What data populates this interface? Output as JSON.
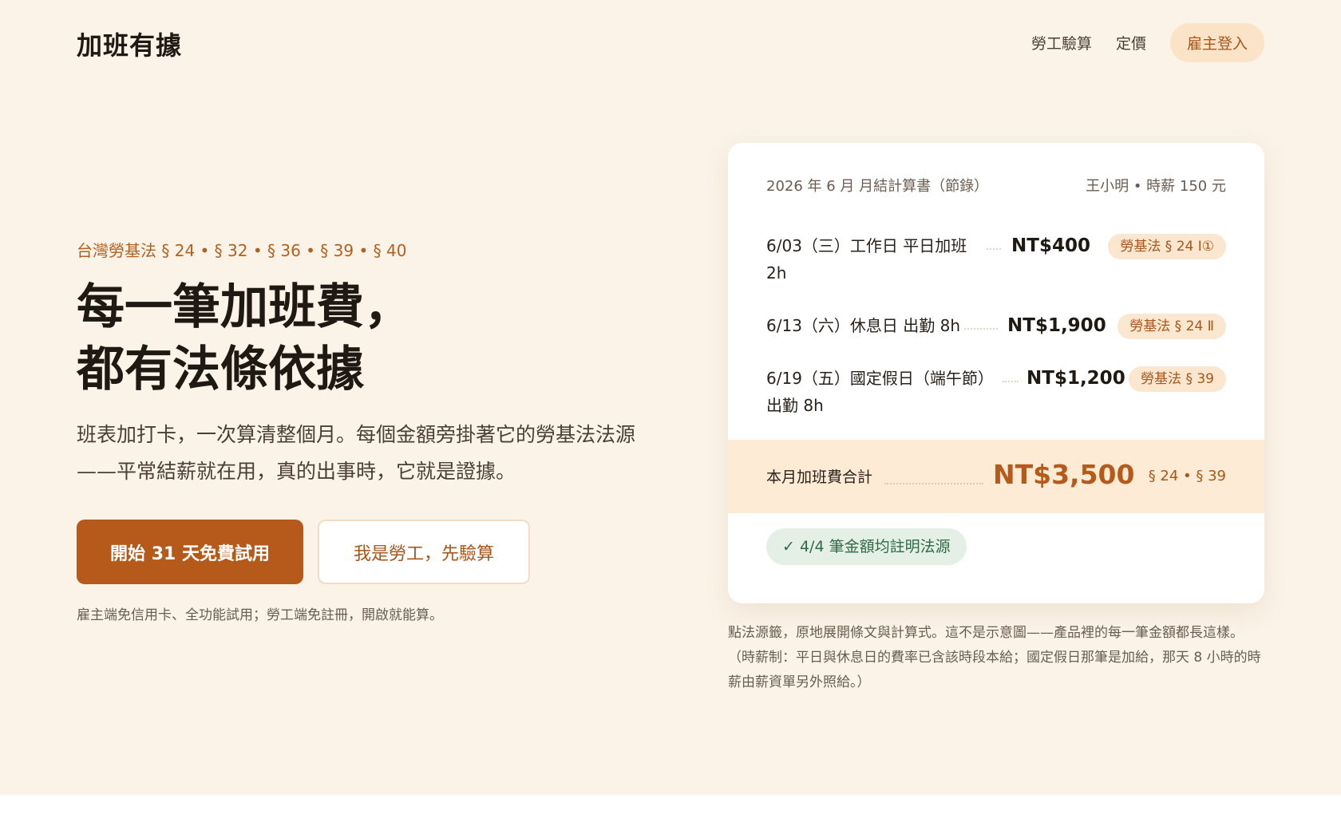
{
  "header": {
    "logo": "加班有據",
    "nav": [
      "勞工驗算",
      "定價"
    ],
    "login_label": "雇主登入"
  },
  "hero": {
    "eyebrow": "台灣勞基法 § 24 • § 32 • § 36 • § 39 • § 40",
    "headline_line1": "每一筆加班費，",
    "headline_line2": "都有法條依據",
    "lead": "班表加打卡，一次算清整個月。每個金額旁掛著它的勞基法法源——平常結薪就在用，真的出事時，它就是證據。",
    "cta_primary": "開始 31 天免費試用",
    "cta_secondary": "我是勞工，先驗算",
    "footnote": "雇主端免信用卡、全功能試用；勞工端免註冊，開啟就能算。"
  },
  "statement": {
    "title": "2026 年 6 月 月結計算書（節錄）",
    "employee": "王小明 • 時薪 150 元",
    "rows": [
      {
        "label": "6/03（三）工作日 平日加班 2h",
        "amount": "NT$400",
        "law": "勞基法 § 24 Ⅰ①"
      },
      {
        "label": "6/13（六）休息日 出勤 8h",
        "amount": "NT$1,900",
        "law": "勞基法 § 24 Ⅱ"
      },
      {
        "label": "6/19（五）國定假日（端午節）出勤 8h",
        "amount": "NT$1,200",
        "law": "勞基法 § 39"
      }
    ],
    "total_label": "本月加班費合計",
    "total_amount": "NT$3,500",
    "total_refs": "§ 24 • § 39",
    "verify": "✓ 4/4 筆金額均註明法源"
  },
  "caption": {
    "line1": "點法源籤，原地展開條文與計算式。這不是示意圖——產品裡的每一筆金額都長這樣。",
    "line2": "（時薪制：平日與休息日的費率已含該時段本給；國定假日那筆是加給，那天 8 小時的時薪由薪資單另外照給。）"
  }
}
